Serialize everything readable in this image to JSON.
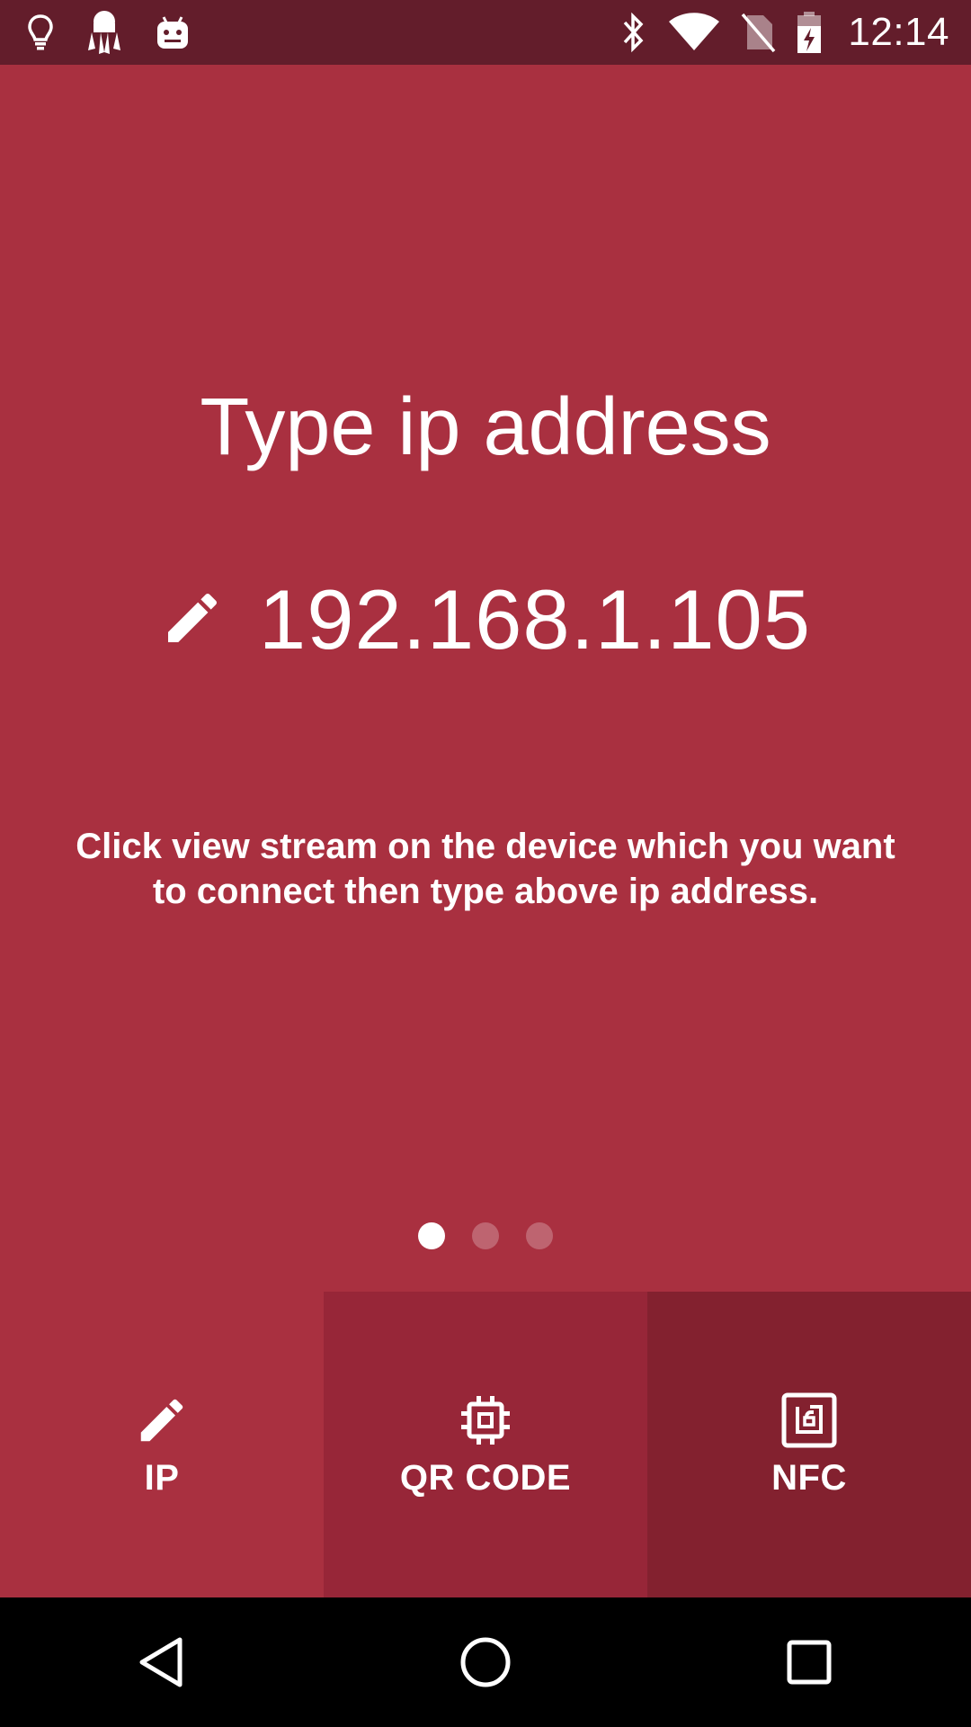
{
  "status_bar": {
    "time": "12:14",
    "left_icons": [
      "lightbulb-icon",
      "spider-app-icon",
      "android-debug-icon"
    ],
    "right_icons": [
      "bluetooth-icon",
      "wifi-icon",
      "no-sim-icon",
      "battery-charging-icon"
    ]
  },
  "main": {
    "title": "Type ip address",
    "ip_address": "192.168.1.105",
    "ip_icon": "pencil-icon",
    "instruction": "Click view stream on the device which you want to connect then type above ip address.",
    "pager": {
      "page_count": 3,
      "active_index": 0
    }
  },
  "tabs": [
    {
      "label": "IP",
      "icon": "pencil-icon",
      "color": "#a93040",
      "selected": true
    },
    {
      "label": "QR CODE",
      "icon": "chip-icon",
      "color": "#972638",
      "selected": false
    },
    {
      "label": "NFC",
      "icon": "nfc-icon",
      "color": "#83212f",
      "selected": false
    }
  ],
  "nav_bar": {
    "buttons": [
      "back-icon",
      "home-icon",
      "recents-icon"
    ]
  },
  "colors": {
    "status_bar": "#631d2b",
    "primary": "#a93040",
    "nav_bar": "#000000",
    "text": "#ffffff"
  }
}
